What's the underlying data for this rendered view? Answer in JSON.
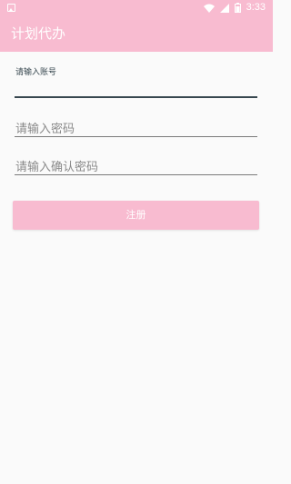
{
  "status_bar": {
    "left_icon": "image-icon",
    "icons": [
      "wifi-icon",
      "signal-icon",
      "battery-icon"
    ],
    "time": "3:33"
  },
  "app_bar": {
    "title": "计划代办"
  },
  "form": {
    "account_placeholder": "请输入账号",
    "password_placeholder": "请输入密码",
    "confirm_placeholder": "请输入确认密码",
    "register_label": "注册"
  },
  "colors": {
    "primary": "#f8bbd0",
    "focus_underline": "#37474f",
    "background": "#fafafa"
  }
}
